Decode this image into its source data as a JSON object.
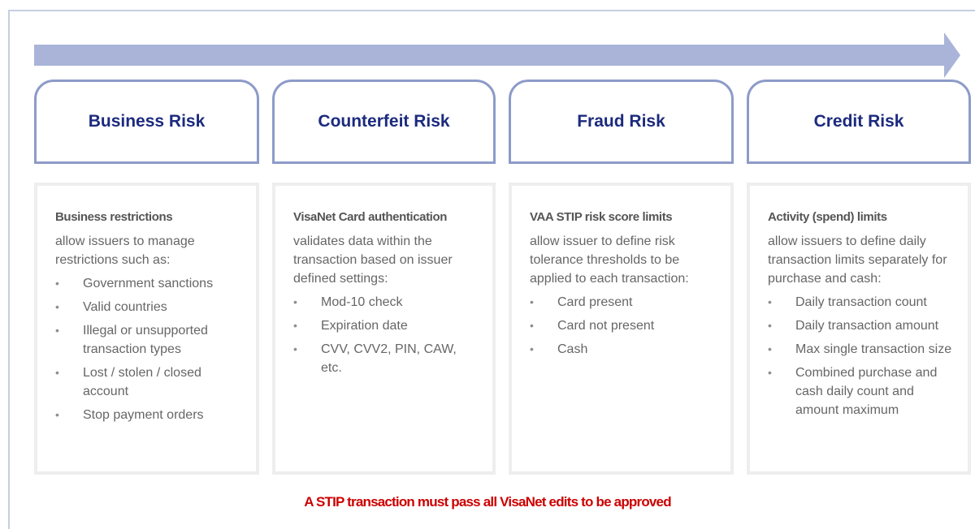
{
  "colors": {
    "arrow": "#a9b4d8",
    "header_border": "#8d9bc9",
    "header_text": "#1c2a7d",
    "content_border": "#eeeeee",
    "footer_text": "#cc0000"
  },
  "columns": [
    {
      "title": "Business Risk",
      "subhead": "Business restrictions",
      "description": "allow issuers to manage restrictions such as:",
      "items": [
        "Government sanctions",
        "Valid countries",
        "Illegal or unsupported transaction types",
        "Lost / stolen / closed account",
        "Stop payment orders"
      ]
    },
    {
      "title": "Counterfeit Risk",
      "subhead": "VisaNet Card authentication",
      "description": "validates data within the transaction based on issuer defined settings:",
      "items": [
        "Mod-10 check",
        "Expiration date",
        "CVV, CVV2, PIN, CAW, etc."
      ]
    },
    {
      "title": "Fraud Risk",
      "subhead": "VAA STIP risk score limits",
      "description": "allow issuer to define risk tolerance thresholds to be applied to each transaction:",
      "items": [
        "Card present",
        "Card not present",
        "Cash"
      ]
    },
    {
      "title": "Credit Risk",
      "subhead": "Activity (spend) limits",
      "description": "allow issuers to define daily transaction limits separately for purchase and cash:",
      "items": [
        "Daily transaction count",
        "Daily transaction amount",
        "Max single transaction size",
        "Combined purchase and cash daily count and amount maximum"
      ]
    }
  ],
  "footer": {
    "note": "A STIP transaction must pass all VisaNet edits to be approved"
  }
}
